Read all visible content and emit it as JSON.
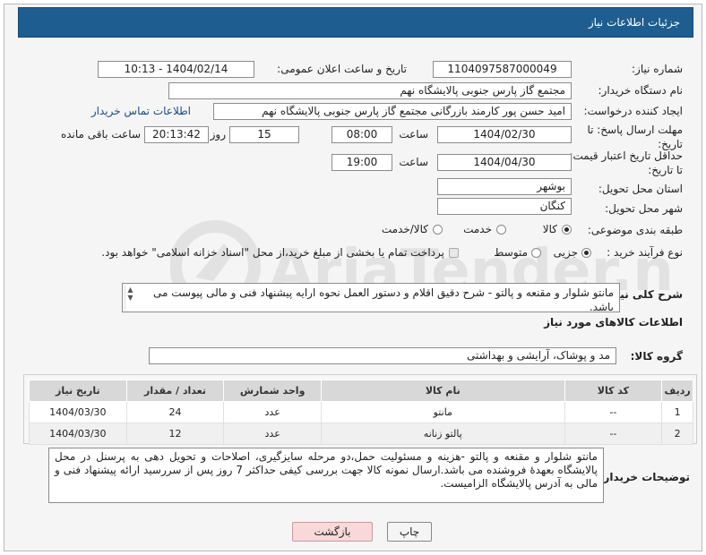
{
  "header": {
    "title": "جزئیات اطلاعات نیاز"
  },
  "fields": {
    "need_number_label": "شماره نیاز:",
    "need_number": "1104097587000049",
    "announce_label": "تاریخ و ساعت اعلان عمومی:",
    "announce_value": "1404/02/14 - 10:13",
    "buyer_org_label": "نام دستگاه خریدار:",
    "buyer_org": "مجتمع گاز پارس جنوبی  پالایشگاه نهم",
    "requester_label": "ایجاد کننده درخواست:",
    "requester": "امید حسن پور کارمند بازرگانی مجتمع گاز پارس جنوبی  پالایشگاه نهم",
    "buyer_contact_link": "اطلاعات تماس خریدار",
    "deadline_label": "مهلت ارسال پاسخ: تا تاریخ:",
    "deadline_date": "1404/02/30",
    "time_label": "ساعت",
    "deadline_time": "08:00",
    "days_value": "15",
    "days_label": "روز و",
    "remaining_time": "20:13:42",
    "remaining_label": "ساعت باقی مانده",
    "validity_label": "حداقل تاریخ اعتبار قیمت: تا تاریخ:",
    "validity_date": "1404/04/30",
    "validity_time": "19:00",
    "province_label": "استان محل تحویل:",
    "province": "بوشهر",
    "city_label": "شهر محل تحویل:",
    "city": "کنگان",
    "category_label": "طبقه بندی موضوعی:",
    "category_options": [
      "کالا",
      "خدمت",
      "کالا/خدمت"
    ],
    "process_label": "نوع فرآیند خرید :",
    "process_options": [
      "جزیی",
      "متوسط"
    ],
    "payment_note": "پرداخت تمام یا بخشی از مبلغ خرید،از محل \"اسناد خزانه اسلامی\" خواهد بود.",
    "summary_label": "شرح کلی نیاز:",
    "summary_text": "مانتو شلوار و مقنعه و  پالتو - شرح دقیق اقلام و دستور العمل نحوه ارایه پیشنهاد فنی و مالی پیوست می باشد.",
    "goods_info_title": "اطلاعات کالاهای مورد نیاز",
    "goods_group_label": "گروه کالا:",
    "goods_group": "مد و پوشاک، آرایشی و بهداشتی",
    "buyer_notes_label": "توضیحات خریدار:",
    "buyer_notes": "مانتو شلوار و مقنعه و پالتو -هزینه و مسئولیت حمل،دو مرحله سایزگیری، اصلاحات و تحویل دهی به پرسنل در محل پالایشگاه بعهدهٔ فروشنده می باشد.ارسال نمونه کالا جهت بررسی کیفی حداکثر 7 روز پس از سررسید ارائه پیشنهاد فنی و مالی به آدرس پالایشگاه الزامیست."
  },
  "table": {
    "headers": [
      "ردیف",
      "کد کالا",
      "نام کالا",
      "واحد شمارش",
      "تعداد / مقدار",
      "تاریخ نیاز"
    ],
    "rows": [
      [
        "1",
        "--",
        "مانتو",
        "عدد",
        "24",
        "1404/03/30"
      ],
      [
        "2",
        "--",
        "پالتو زنانه",
        "عدد",
        "12",
        "1404/03/30"
      ]
    ]
  },
  "buttons": {
    "print": "چاپ",
    "back": "بازگشت"
  },
  "watermark": {
    "text": "AriaTender.net"
  },
  "colors": {
    "title_bg": "#1d5d8f",
    "link": "#1a4b8c",
    "back_btn": "#f8d8d8"
  }
}
